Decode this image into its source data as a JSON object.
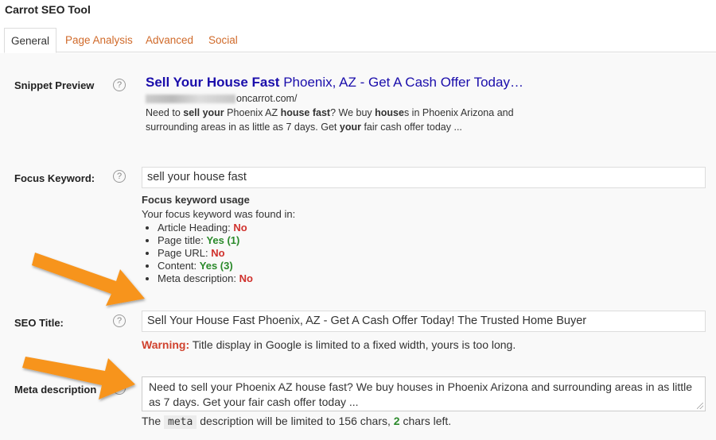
{
  "panel": {
    "title": "Carrot SEO Tool"
  },
  "tabs": [
    {
      "label": "General"
    },
    {
      "label": "Page Analysis"
    },
    {
      "label": "Advanced"
    },
    {
      "label": "Social"
    }
  ],
  "help_icon_glyph": "?",
  "snippet": {
    "label": "Snippet Preview",
    "title_bold": "Sell Your House Fast",
    "title_rest": " Phoenix, AZ - Get A Cash Offer Today…",
    "url_visible": "oncarrot.com/",
    "desc": {
      "p1": "Need to ",
      "b1": "sell your",
      "p2": " Phoenix AZ ",
      "b2": "house fast",
      "p3": "? We buy ",
      "b3": "house",
      "p4": "s in Phoenix Arizona and surrounding areas in as little as 7 days. Get ",
      "b4": "your",
      "p5": " fair cash offer today ..."
    }
  },
  "focus_keyword": {
    "label": "Focus Keyword:",
    "value": "sell your house fast",
    "usage_title": "Focus keyword usage",
    "usage_intro": "Your focus keyword was found in:",
    "items": [
      {
        "label": "Article Heading: ",
        "status": "No"
      },
      {
        "label": "Page title: ",
        "status": "Yes (1)"
      },
      {
        "label": "Page URL: ",
        "status": "No"
      },
      {
        "label": "Content: ",
        "status": "Yes (3)"
      },
      {
        "label": "Meta description: ",
        "status": "No"
      }
    ]
  },
  "seo_title": {
    "label": "SEO Title:",
    "value": "Sell Your House Fast Phoenix, AZ - Get A Cash Offer Today! The Trusted Home Buyer",
    "warning_label": "Warning:",
    "warning_text": " Title display in Google is limited to a fixed width, yours is too long."
  },
  "meta_description": {
    "label": "Meta description",
    "value": "Need to sell your Phoenix AZ house fast? We buy houses in Phoenix Arizona and surrounding areas in as little as 7 days. Get your fair cash offer today ...",
    "note_p1": "The ",
    "note_code": "meta",
    "note_p2": " description will be limited to 156 chars, ",
    "note_count": "2",
    "note_p3": " chars left."
  },
  "colors": {
    "tab_link": "#d06a2a",
    "snippet_title": "#1a0dab",
    "status_no": "#d0312d",
    "status_yes": "#2b8a2b",
    "arrow": "#f7941d"
  }
}
